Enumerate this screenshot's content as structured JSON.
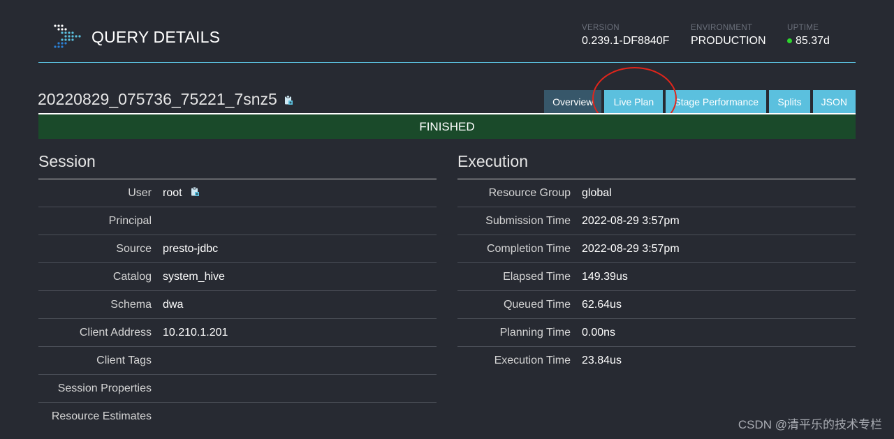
{
  "header": {
    "title": "QUERY DETAILS",
    "stats": [
      {
        "label": "VERSION",
        "value": "0.239.1-DF8840F"
      },
      {
        "label": "ENVIRONMENT",
        "value": "PRODUCTION"
      },
      {
        "label": "UPTIME",
        "value": "85.37d"
      }
    ],
    "uptime_status_color": "#2dd52d"
  },
  "query": {
    "id": "20220829_075736_75221_7snz5",
    "copy_icon": "clipboard-icon"
  },
  "tabs": [
    {
      "label": "Overview",
      "active": true
    },
    {
      "label": "Live Plan",
      "active": false
    },
    {
      "label": "Stage Performance",
      "active": false
    },
    {
      "label": "Splits",
      "active": false
    },
    {
      "label": "JSON",
      "active": false
    }
  ],
  "status": {
    "label": "FINISHED",
    "color": "#1a4a2a"
  },
  "session": {
    "title": "Session",
    "rows": [
      {
        "key": "User",
        "value": "root"
      },
      {
        "key": "Principal",
        "value": ""
      },
      {
        "key": "Source",
        "value": "presto-jdbc"
      },
      {
        "key": "Catalog",
        "value": "system_hive"
      },
      {
        "key": "Schema",
        "value": "dwa"
      },
      {
        "key": "Client Address",
        "value": "10.210.1.201"
      },
      {
        "key": "Client Tags",
        "value": ""
      },
      {
        "key": "Session Properties",
        "value": ""
      },
      {
        "key": "Resource Estimates",
        "value": ""
      }
    ]
  },
  "execution": {
    "title": "Execution",
    "rows": [
      {
        "key": "Resource Group",
        "value": "global"
      },
      {
        "key": "Submission Time",
        "value": "2022-08-29 3:57pm"
      },
      {
        "key": "Completion Time",
        "value": "2022-08-29 3:57pm"
      },
      {
        "key": "Elapsed Time",
        "value": "149.39us"
      },
      {
        "key": "Queued Time",
        "value": "62.64us"
      },
      {
        "key": "Planning Time",
        "value": "0.00ns"
      },
      {
        "key": "Execution Time",
        "value": "23.84us"
      }
    ]
  },
  "watermark": "CSDN @清平乐的技术专栏",
  "colors": {
    "accent": "#5bc0de",
    "tab_active": "#37576a",
    "background": "#272a32",
    "annotation": "#e0251b"
  }
}
